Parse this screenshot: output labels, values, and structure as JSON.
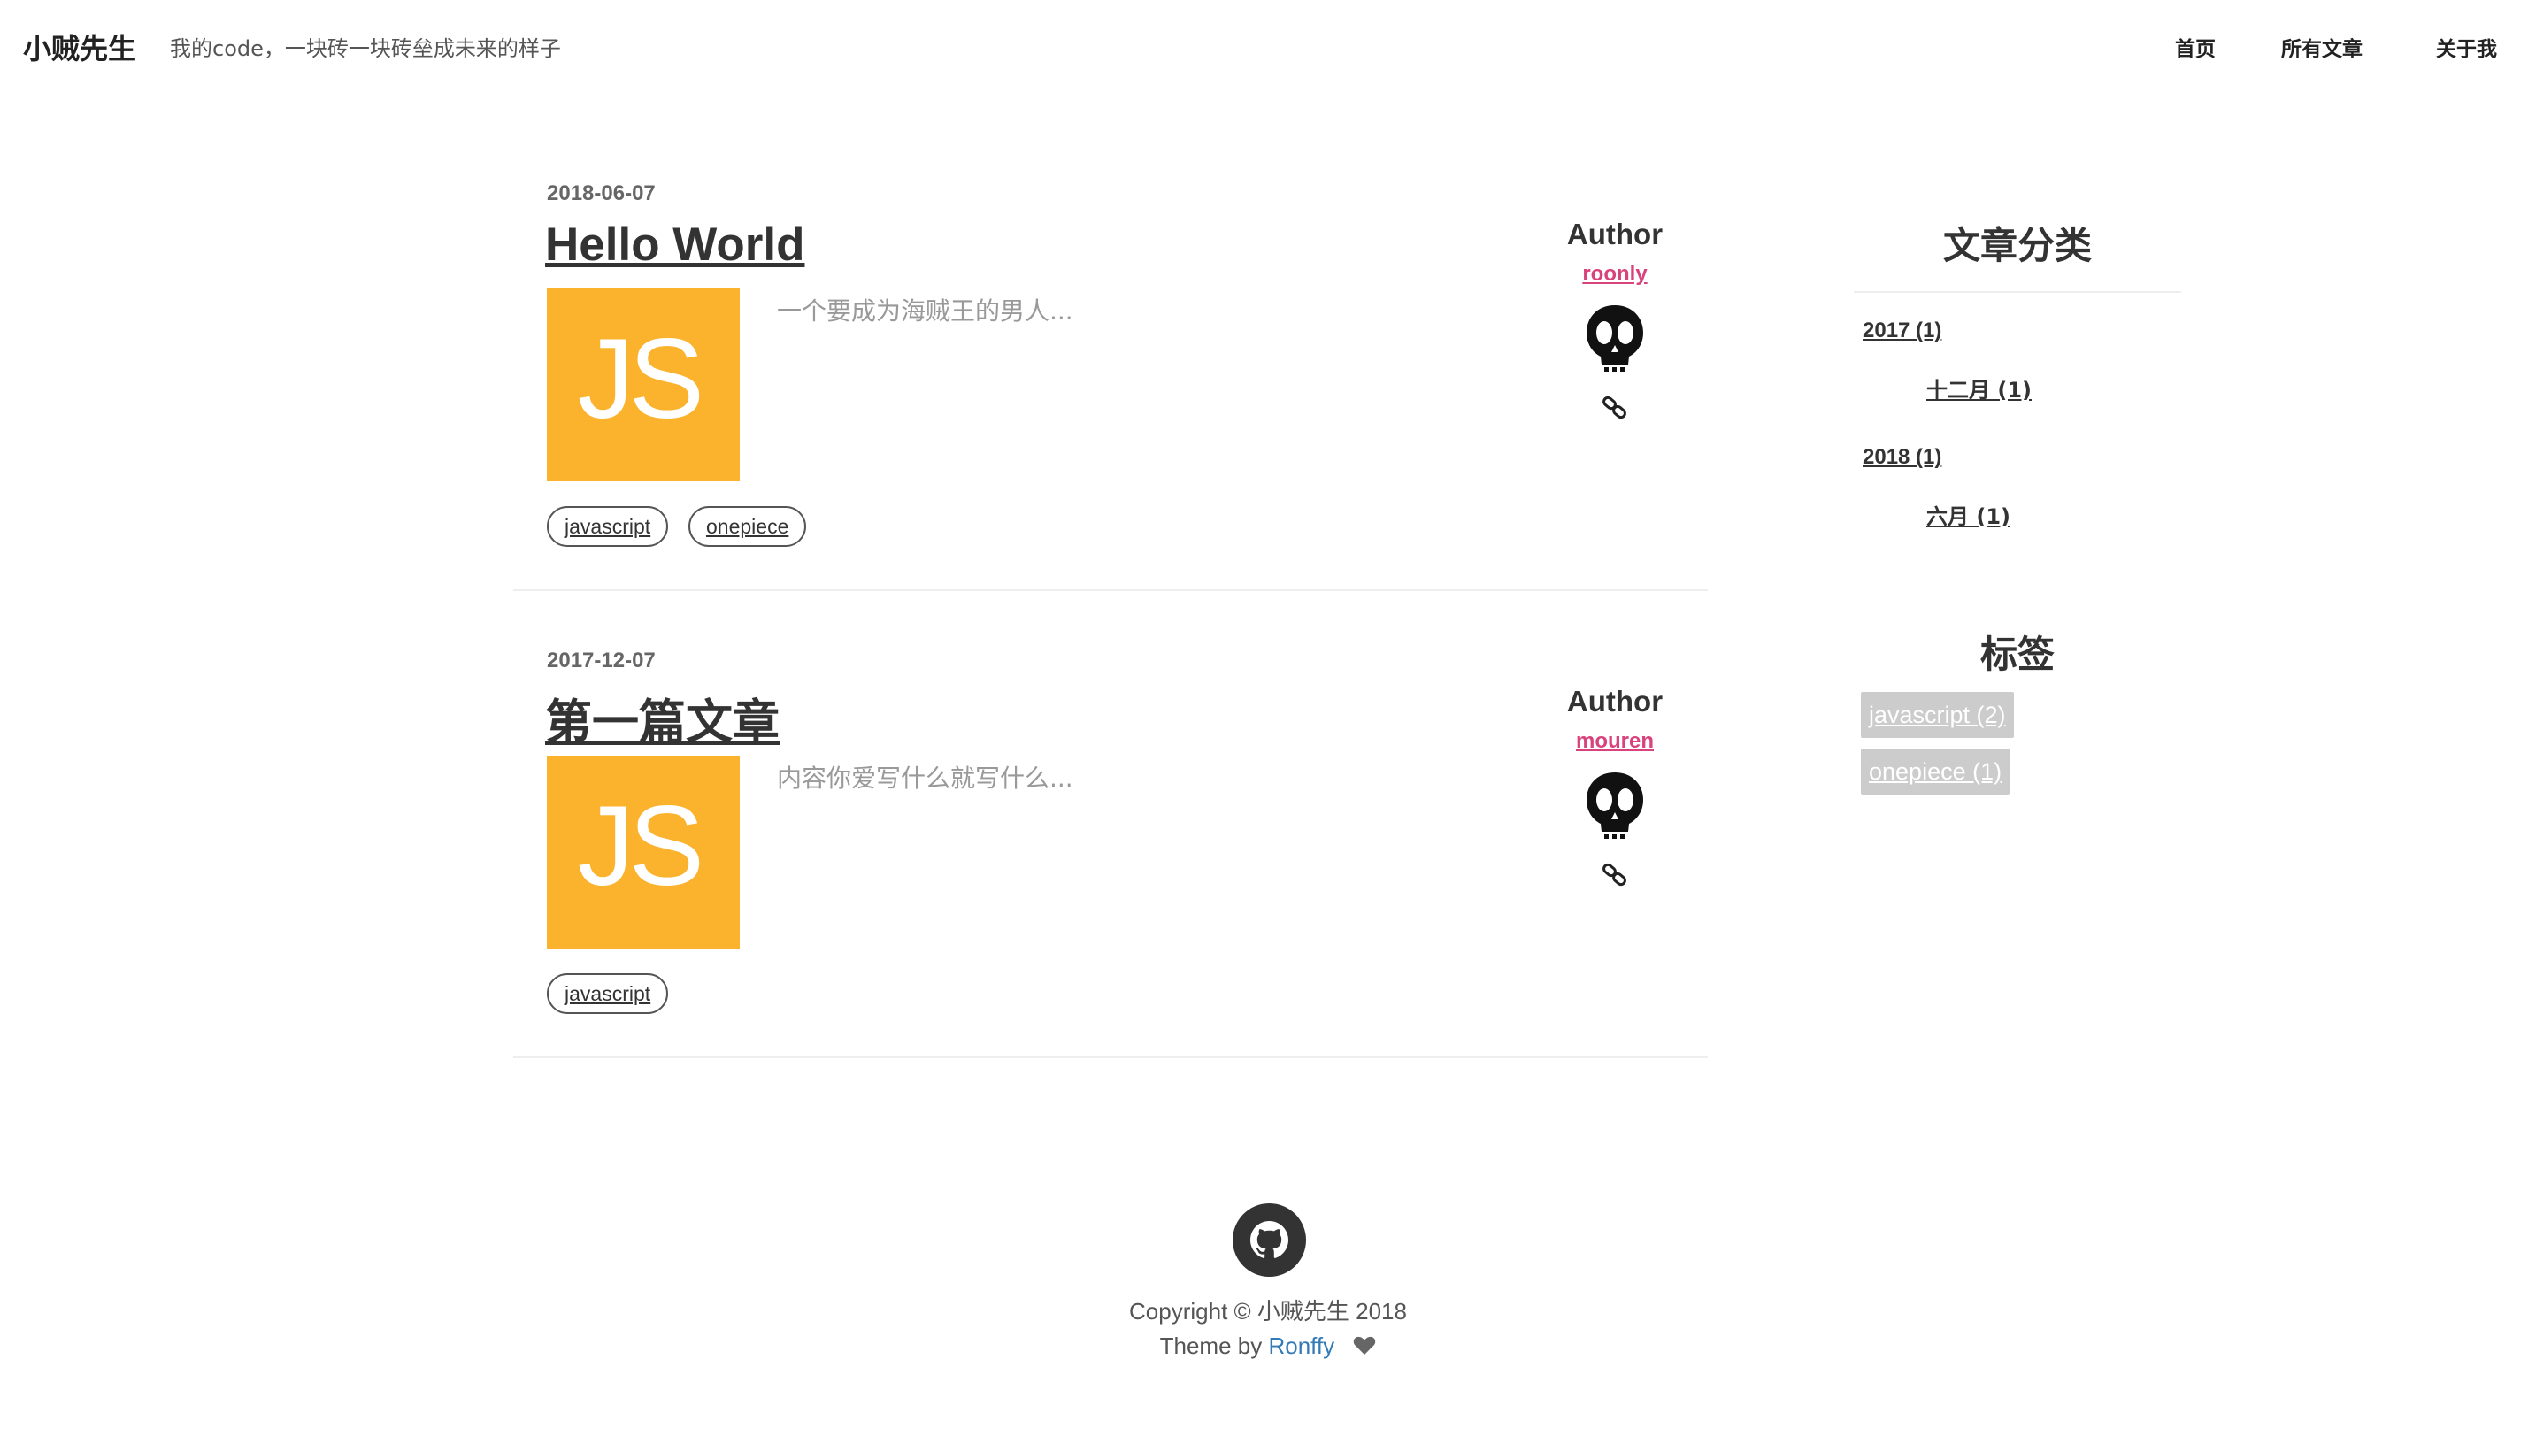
{
  "header": {
    "brand": "小贼先生",
    "motto": "我的code，一块砖一块砖垒成未来的样子",
    "nav": [
      {
        "label": "首页"
      },
      {
        "label": "所有文章"
      },
      {
        "label": "关于我"
      }
    ]
  },
  "posts": [
    {
      "date": "2018-06-07",
      "title": "Hello World",
      "thumb_text": "JS",
      "excerpt": "一个要成为海贼王的男人...",
      "tags": [
        "javascript",
        "onepiece"
      ],
      "author_label": "Author",
      "author_name": "roonly",
      "avatar_icon": "skull-icon",
      "link_icon": "link-icon"
    },
    {
      "date": "2017-12-07",
      "title": "第一篇文章",
      "thumb_text": "JS",
      "excerpt": "内容你爱写什么就写什么...",
      "tags": [
        "javascript"
      ],
      "author_label": "Author",
      "author_name": "mouren",
      "avatar_icon": "skull-icon",
      "link_icon": "link-icon"
    }
  ],
  "sidebar": {
    "archive_title": "文章分类",
    "archive": [
      {
        "year": "2017 (1)",
        "months": [
          "十二月 (1)"
        ]
      },
      {
        "year": "2018 (1)",
        "months": [
          "六月 (1)"
        ]
      }
    ],
    "tags_title": "标签",
    "tags": [
      "javascript (2)",
      "onepiece (1)"
    ]
  },
  "footer": {
    "github_icon": "github-icon",
    "copyright": "Copyright © 小贼先生 2018",
    "theme_prefix": "Theme by ",
    "theme_author": "Ronffy",
    "heart_icon": "heart-icon"
  },
  "colors": {
    "accent_pink": "#d9437c",
    "js_yellow": "#fbb22d",
    "link_blue": "#337ab7",
    "tag_gray": "#cccccc"
  }
}
